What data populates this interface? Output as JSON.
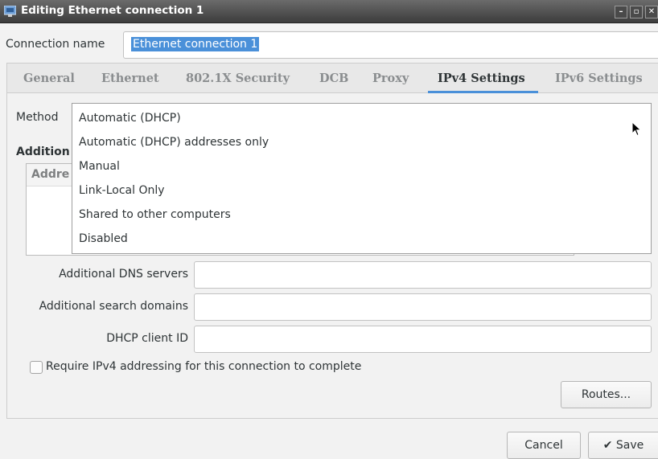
{
  "window": {
    "title": "Editing Ethernet connection 1",
    "buttons": {
      "minimize": "–",
      "restore": "▫",
      "close": "✕"
    }
  },
  "connection": {
    "label": "Connection name",
    "value": "Ethernet connection 1"
  },
  "tabs": [
    {
      "label": "General"
    },
    {
      "label": "Ethernet"
    },
    {
      "label": "802.1X Security"
    },
    {
      "label": "DCB"
    },
    {
      "label": "Proxy"
    },
    {
      "label": "IPv4 Settings"
    },
    {
      "label": "IPv6 Settings"
    }
  ],
  "active_tab": "IPv4 Settings",
  "ipv4": {
    "method_label": "Method",
    "additional_heading": "Addition",
    "address_column": "Addre",
    "method_options": [
      "Automatic (DHCP)",
      "Automatic (DHCP) addresses only",
      "Manual",
      "Link-Local Only",
      "Shared to other computers",
      "Disabled"
    ],
    "dns_label": "Additional DNS servers",
    "dns_value": "",
    "search_label": "Additional search domains",
    "search_value": "",
    "dhcp_label": "DHCP client ID",
    "dhcp_value": "",
    "require_label": "Require IPv4 addressing for this connection to complete",
    "require_checked": false,
    "routes_button": "Routes..."
  },
  "footer": {
    "cancel": "Cancel",
    "save": "Save",
    "save_icon": "✔"
  },
  "colors": {
    "accent": "#4a90d9",
    "titlebar": "#3c3c3c"
  }
}
